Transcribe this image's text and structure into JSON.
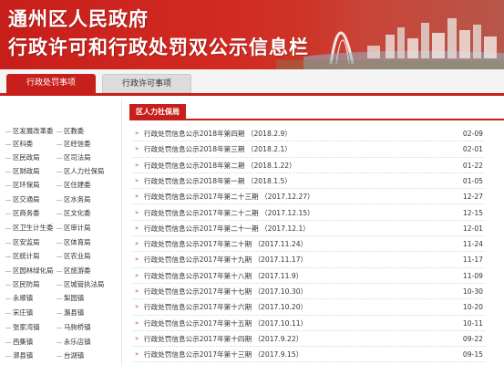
{
  "banner": {
    "title": "通州区人民政府",
    "subtitle": "行政许可和行政处罚双公示信息栏"
  },
  "tabs": [
    {
      "label": "行政处罚事项",
      "active": true
    },
    {
      "label": "行政许可事项",
      "active": false
    }
  ],
  "sidebar": {
    "items": [
      {
        "label": "区发展改革委"
      },
      {
        "label": "区教委"
      },
      {
        "label": "区科委"
      },
      {
        "label": "区经信委"
      },
      {
        "label": "区民政局"
      },
      {
        "label": "区司法局"
      },
      {
        "label": "区财政局"
      },
      {
        "label": "区人力社保局"
      },
      {
        "label": "区环保局"
      },
      {
        "label": "区住建委"
      },
      {
        "label": "区交通局"
      },
      {
        "label": "区水务局"
      },
      {
        "label": "区商务委"
      },
      {
        "label": "区文化委"
      },
      {
        "label": "区卫生计生委"
      },
      {
        "label": "区审计局"
      },
      {
        "label": "区安监局"
      },
      {
        "label": "区体育局"
      },
      {
        "label": "区统计局"
      },
      {
        "label": "区农业局"
      },
      {
        "label": "区园林绿化局"
      },
      {
        "label": "区旅游委"
      },
      {
        "label": "区民防局"
      },
      {
        "label": "区城管执法局"
      },
      {
        "label": "永顺镇"
      },
      {
        "label": "梨园镇"
      },
      {
        "label": "宋庄镇"
      },
      {
        "label": "潞县镇"
      },
      {
        "label": "张家湾镇"
      },
      {
        "label": "马驹桥镇"
      },
      {
        "label": "西集镇"
      },
      {
        "label": "永乐店镇"
      },
      {
        "label": "漷县镇"
      },
      {
        "label": "台湖镇"
      }
    ]
  },
  "main": {
    "section_label": "区人力社保局",
    "rows": [
      {
        "title": "行政处罚信息公示2018年第四期 （2018.2.9）",
        "date": "02-09"
      },
      {
        "title": "行政处罚信息公示2018年第三期 （2018.2.1）",
        "date": "02-01"
      },
      {
        "title": "行政处罚信息公示2018年第二期 （2018.1.22）",
        "date": "01-22"
      },
      {
        "title": "行政处罚信息公示2018年第一期 （2018.1.5）",
        "date": "01-05"
      },
      {
        "title": "行政处罚信息公示2017年第二十三期 （2017.12.27）",
        "date": "12-27"
      },
      {
        "title": "行政处罚信息公示2017年第二十二期 （2017.12.15）",
        "date": "12-15"
      },
      {
        "title": "行政处罚信息公示2017年第二十一期 （2017.12.1）",
        "date": "12-01"
      },
      {
        "title": "行政处罚信息公示2017年第二十期 （2017.11.24）",
        "date": "11-24"
      },
      {
        "title": "行政处罚信息公示2017年第十九期 （2017.11.17）",
        "date": "11-17"
      },
      {
        "title": "行政处罚信息公示2017年第十八期 （2017.11.9）",
        "date": "11-09"
      },
      {
        "title": "行政处罚信息公示2017年第十七期 （2017.10.30）",
        "date": "10-30"
      },
      {
        "title": "行政处罚信息公示2017年第十六期 （2017.10.20）",
        "date": "10-20"
      },
      {
        "title": "行政处罚信息公示2017年第十五期 （2017.10.11）",
        "date": "10-11"
      },
      {
        "title": "行政处罚信息公示2017年第十四期 （2017.9.22）",
        "date": "09-22"
      },
      {
        "title": "行政处罚信息公示2017年第十三期 （2017.9.15）",
        "date": "09-15"
      }
    ]
  },
  "icons": {
    "row_bullet": "double-chevron-right-icon"
  },
  "colors": {
    "brand_red": "#c71f1b",
    "bullet": "#d04a3a"
  }
}
